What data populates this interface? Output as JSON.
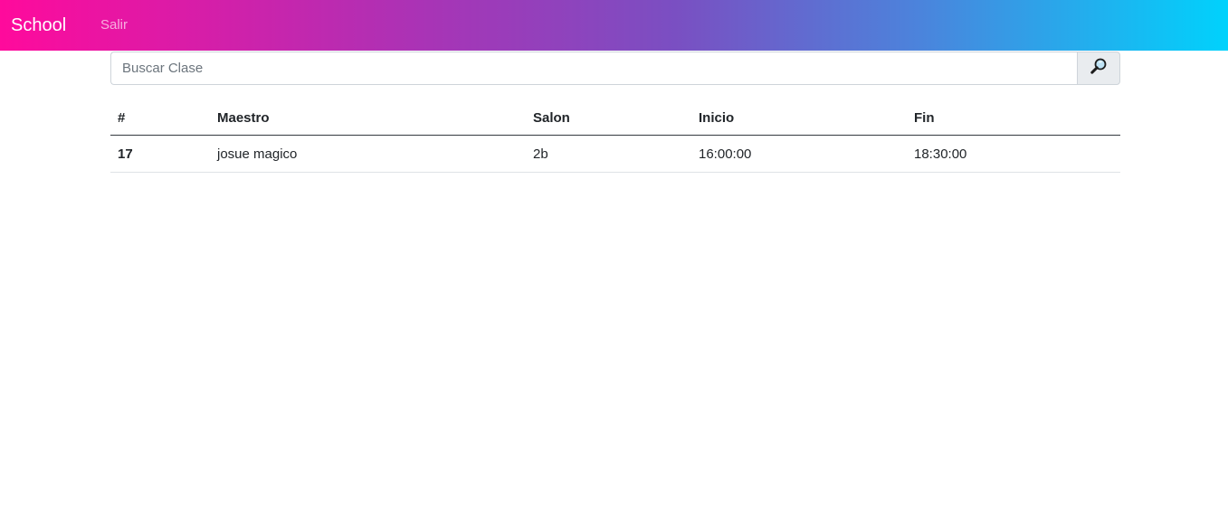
{
  "navbar": {
    "brand": "School",
    "links": [
      {
        "label": "Salir"
      }
    ],
    "gradient": [
      "#ff0a9c",
      "#a834b6",
      "#7a4fc2",
      "#4b84dc",
      "#00d2fc"
    ]
  },
  "search": {
    "placeholder": "Buscar Clase",
    "value": "",
    "button_icon": "search-icon"
  },
  "table": {
    "headers": [
      "#",
      "Maestro",
      "Salon",
      "Inicio",
      "Fin"
    ],
    "rows": [
      {
        "id": "17",
        "maestro": "josue magico",
        "salon": "2b",
        "inicio": "16:00:00",
        "fin": "18:30:00"
      }
    ]
  }
}
